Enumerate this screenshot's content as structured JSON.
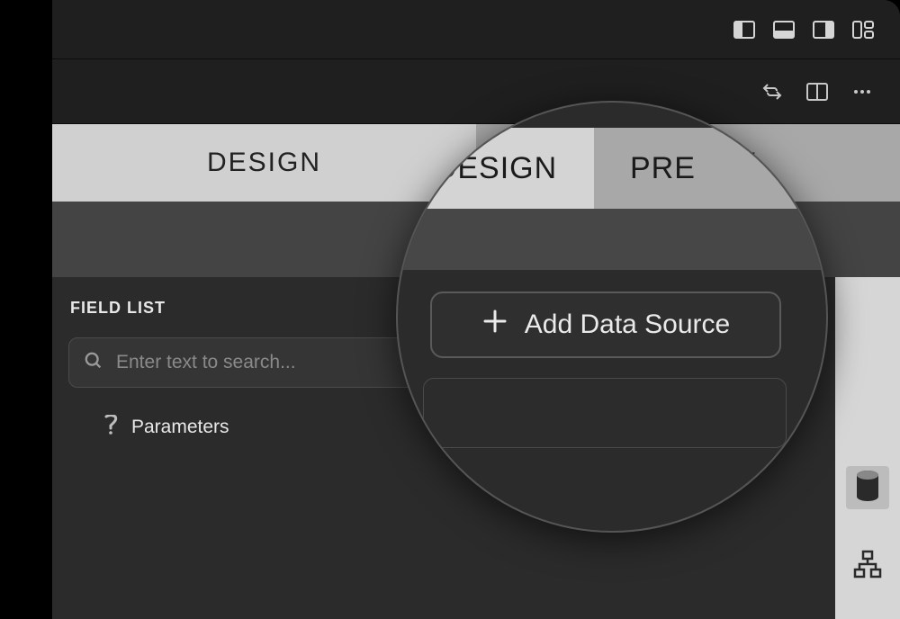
{
  "titlebar": {
    "icons": [
      "panel-left",
      "panel-bottom",
      "panel-right",
      "panel-grid"
    ]
  },
  "toolbar": {
    "icons": [
      "compare-icon",
      "split-icon",
      "more-icon"
    ]
  },
  "tabs": {
    "design": "DESIGN",
    "preview": "PREVIEW"
  },
  "fieldlist": {
    "title": "FIELD LIST",
    "search_placeholder": "Enter text to search...",
    "parameters_label": "Parameters"
  },
  "lens": {
    "design": "DESIGN",
    "preview_partial": "PRE",
    "add_button": "Add Data Source"
  },
  "rail": {
    "items": [
      "database",
      "sitemap"
    ]
  }
}
